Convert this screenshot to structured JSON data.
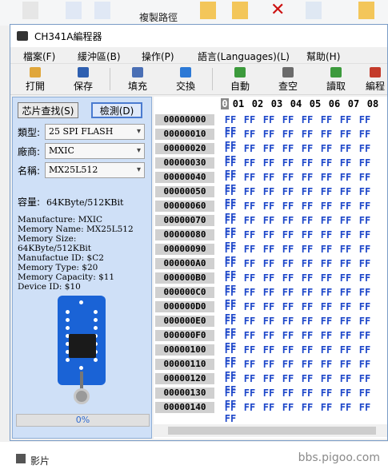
{
  "background": {
    "ribbon_text": "複製路徑",
    "sidebar_items": [
      "影片"
    ],
    "watermark": "bbs.pigoo.com"
  },
  "window": {
    "title": "CH341A編程器"
  },
  "menu": [
    "檔案(F)",
    "緩沖區(B)",
    "操作(P)",
    "語言(Languages)(L)",
    "幫助(H)"
  ],
  "toolbar": [
    {
      "label": "打開",
      "icon": "folder-open-icon",
      "color": "#e0a63a"
    },
    {
      "label": "保存",
      "icon": "save-icon",
      "color": "#2e5fb0"
    },
    {
      "label": "填充",
      "icon": "fill-icon",
      "color": "#4a6fb5"
    },
    {
      "label": "交換",
      "icon": "swap-icon",
      "color": "#2c79d6"
    },
    {
      "label": "自動",
      "icon": "auto-icon",
      "color": "#3c9a3c"
    },
    {
      "label": "查空",
      "icon": "blank-check-icon",
      "color": "#6b6b6b"
    },
    {
      "label": "讀取",
      "icon": "read-icon",
      "color": "#3c9a3c"
    },
    {
      "label": "編程",
      "icon": "program-icon",
      "color": "#c43b2b"
    }
  ],
  "left": {
    "find_chip_label": "芯片查找(S)",
    "detect_label": "檢測(D)",
    "type_label": "類型:",
    "type_value": "25 SPI FLASH",
    "vendor_label": "廠商:",
    "vendor_value": "MXIC",
    "name_label": "名稱:",
    "name_value": "MX25L512",
    "capacity_label": "容量:",
    "capacity_value": "64KByte/512KBit",
    "info": [
      "Manufacture: MXIC",
      "Memory Name: MX25L512",
      "Memory Size: 64KByte/512KBit",
      "Manufactue ID: $C2",
      "Memory Type: $20",
      "Memory Capacity: $11",
      "Device ID: $10"
    ],
    "progress_text": "0%",
    "progress_value": 0
  },
  "hex": {
    "columns": [
      "0",
      "0 1",
      "0 2",
      "0 3",
      "0 4",
      "0 5",
      "0 6",
      "0 7",
      "0 8"
    ],
    "header": [
      "0",
      "01",
      "02",
      "03",
      "04",
      "05",
      "06",
      "07",
      "08"
    ],
    "addresses": [
      "00000000",
      "00000010",
      "00000020",
      "00000030",
      "00000040",
      "00000050",
      "00000060",
      "00000070",
      "00000080",
      "00000090",
      "000000A0",
      "000000B0",
      "000000C0",
      "000000D0",
      "000000E0",
      "000000F0",
      "00000100",
      "00000110",
      "00000120",
      "00000130",
      "00000140"
    ],
    "byte_value": "FF"
  }
}
